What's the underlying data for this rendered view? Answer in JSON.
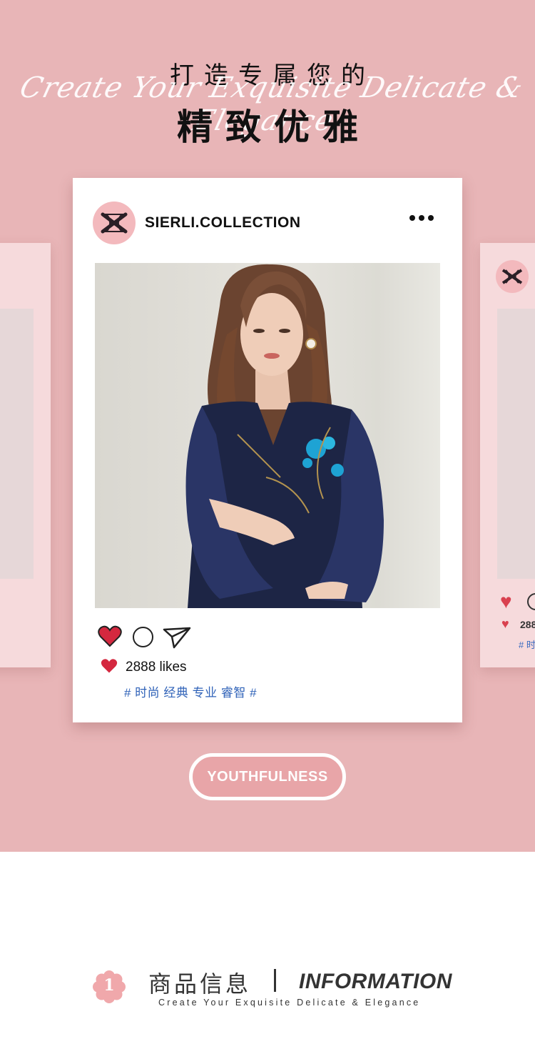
{
  "hero": {
    "title_cn_line1": "打造专属您的",
    "title_script": "Create Your Exquisite Delicate & Elegance",
    "title_cn_line2": "精致优雅"
  },
  "post": {
    "brand": "SIERLI.COLLECTION",
    "likes_text": "2888 likes",
    "tags": "# 时尚 经典 专业 睿智 #",
    "icons": [
      "logo-icon",
      "more-icon",
      "heart-icon",
      "comment-icon",
      "send-icon"
    ],
    "colors": {
      "heart": "#d4283f",
      "tag": "#2f62b8",
      "avatar_bg": "#f3b9bd"
    }
  },
  "side_post": {
    "likes_text": "288",
    "tags": "# 时"
  },
  "badge": {
    "label": "YOUTHFULNESS"
  },
  "info": {
    "number": "1",
    "title_cn": "商品信息",
    "title_en": "INFORMATION",
    "subtitle": "Create Your Exquisite Delicate & Elegance"
  },
  "colors": {
    "hero_bg": "#e8b5b7",
    "side_card": "#f6dadc",
    "pill_bg": "#e8a5a8"
  }
}
